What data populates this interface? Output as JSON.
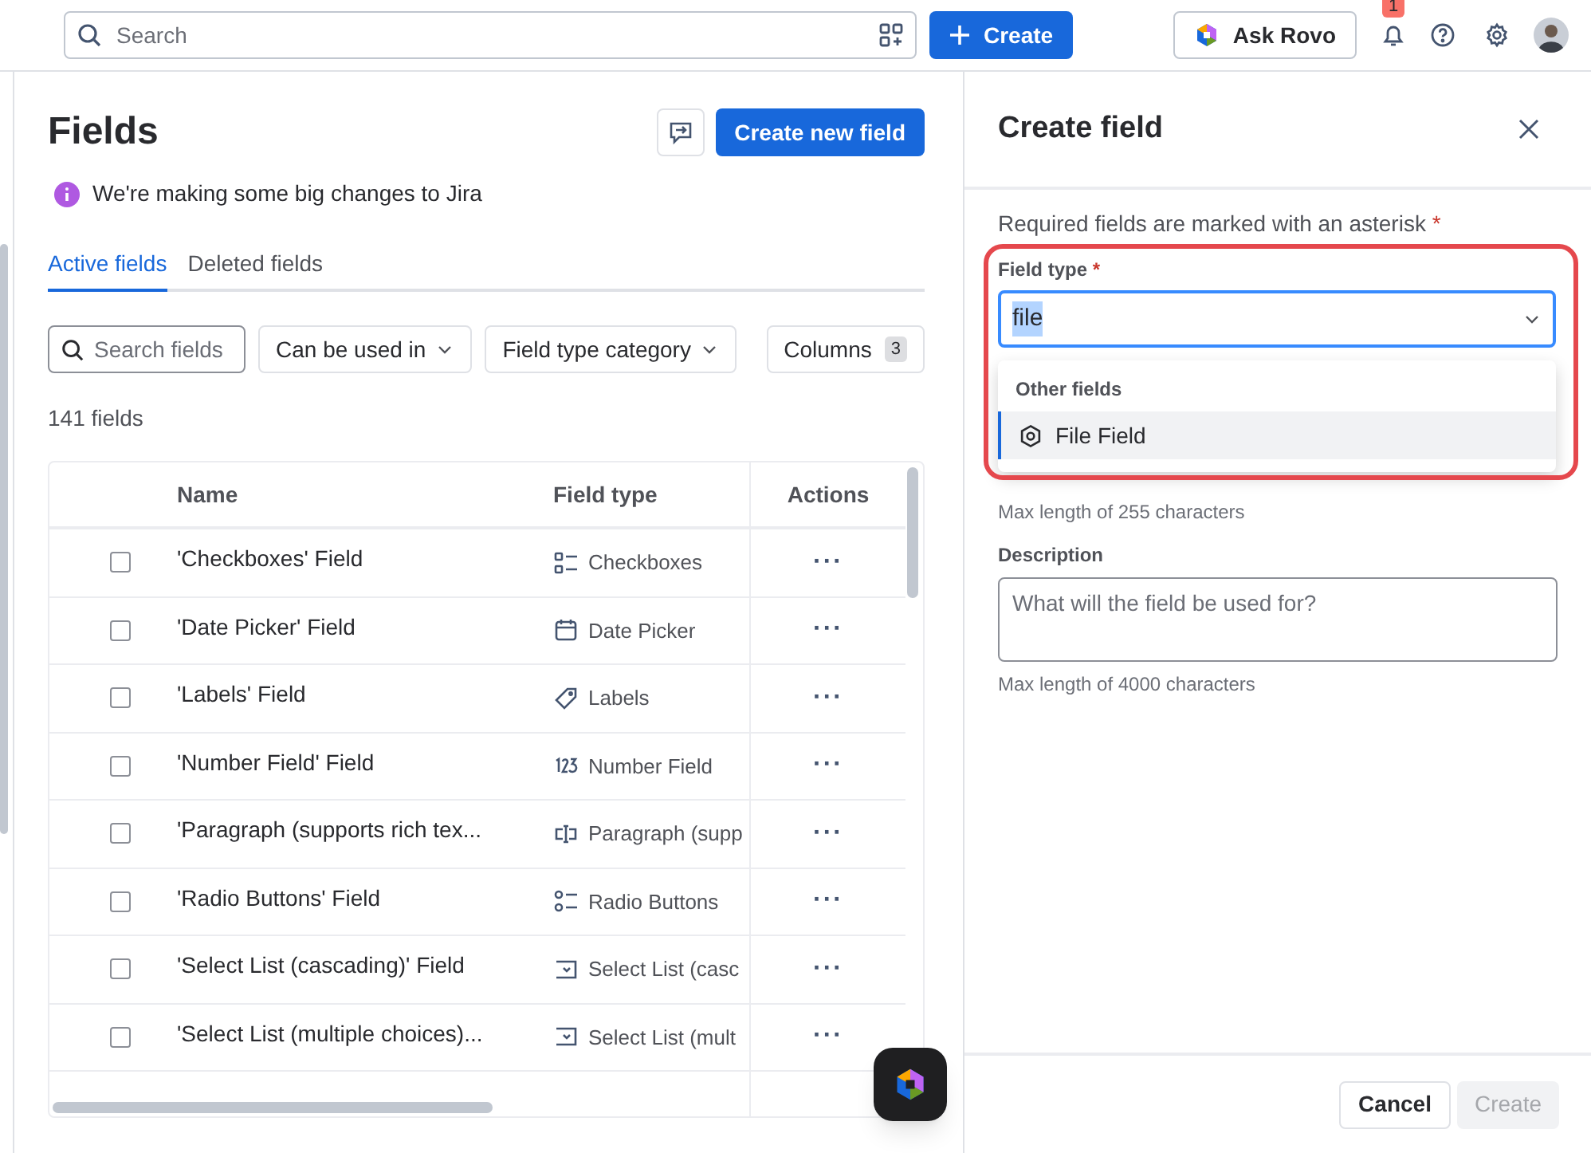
{
  "topbar": {
    "search": {
      "placeholder": "Search"
    },
    "create_button": "Create",
    "ask_button": "Ask Rovo",
    "notifications_badge": "1"
  },
  "page": {
    "title": "Fields",
    "create_button": "Create new field",
    "notice": "We're making some big changes to Jira",
    "tabs": [
      {
        "label": "Active fields",
        "selected": true
      },
      {
        "label": "Deleted fields",
        "selected": false
      }
    ],
    "search": {
      "placeholder": "Search fields"
    },
    "filters": [
      "Can be used in",
      "Field type category"
    ],
    "columns_button": {
      "label": "Columns",
      "count": "3"
    },
    "count": "141 fields",
    "table": {
      "columns": [
        "Name",
        "Field type",
        "Actions"
      ],
      "rows": [
        {
          "checked": false,
          "name": "'Checkboxes' Field",
          "kind": "checkboxes",
          "type": "Checkboxes",
          "actions": "···"
        },
        {
          "checked": false,
          "name": "'Date Picker' Field",
          "kind": "date",
          "type": "Date Picker",
          "actions": "···"
        },
        {
          "checked": false,
          "name": "'Labels' Field",
          "kind": "labels",
          "type": "Labels",
          "actions": "···"
        },
        {
          "checked": false,
          "name": "'Number Field' Field",
          "kind": "number",
          "type": "Number Field",
          "actions": "···"
        },
        {
          "checked": false,
          "name": "'Paragraph (supports rich tex...",
          "kind": "paragraph",
          "type": "Paragraph (supp",
          "actions": "···"
        },
        {
          "checked": false,
          "name": "'Radio Buttons' Field",
          "kind": "radio",
          "type": "Radio Buttons",
          "actions": "···"
        },
        {
          "checked": false,
          "name": "'Select List (cascading)' Field",
          "kind": "select",
          "type": "Select List (casc",
          "actions": "···"
        },
        {
          "checked": false,
          "name": "'Select List (multiple choices)...",
          "kind": "select",
          "type": "Select List (mult",
          "actions": "···"
        }
      ]
    }
  },
  "panel": {
    "title": "Create field",
    "required_note": "Required fields are marked with an asterisk",
    "asterisk": "*",
    "field_type": {
      "label": "Field type",
      "asterisk": "*",
      "value": "file",
      "dropdown": {
        "group": "Other fields",
        "options": [
          {
            "label": "File Field",
            "selected": true
          }
        ]
      }
    },
    "name_hint": "Max length of 255 characters",
    "description": {
      "label": "Description",
      "placeholder": "What will the field be used for?",
      "hint": "Max length of 4000 characters"
    },
    "buttons": [
      {
        "label": "Cancel",
        "disabled": false
      },
      {
        "label": "Create",
        "disabled": true
      }
    ]
  }
}
